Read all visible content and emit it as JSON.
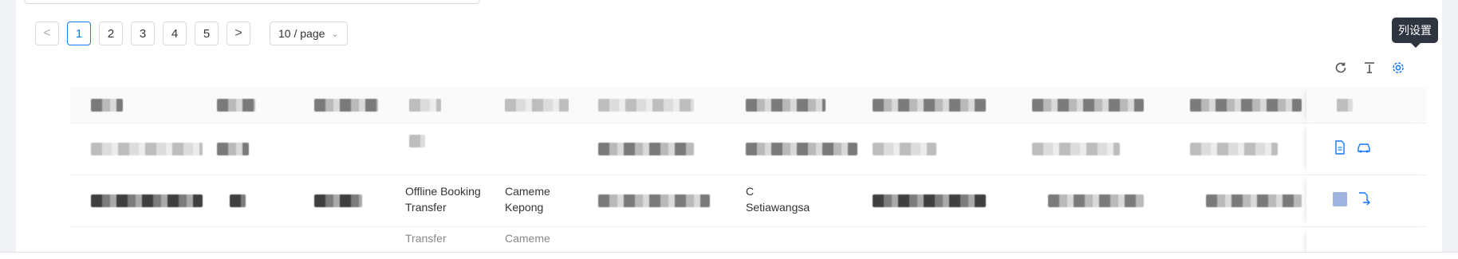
{
  "pagination": {
    "prev_label": "<",
    "next_label": ">",
    "pages": [
      "1",
      "2",
      "3",
      "4",
      "5"
    ],
    "current": "1",
    "page_size": "10 / page"
  },
  "toolbar": {
    "tooltip": "列设置",
    "icons": [
      "refresh-icon",
      "column-height-icon",
      "setting-icon"
    ]
  },
  "table": {
    "rows": [
      {
        "col3": "",
        "col4": "",
        "col6": ""
      },
      {
        "col3": "Offline Booking",
        "col3b": "Transfer",
        "col4": "Cameme",
        "col4b": "Kepong",
        "col6": "C",
        "col6b": "Setiawangsa"
      },
      {
        "col3": "Transfer",
        "col4": "Cameme"
      }
    ]
  },
  "colors": {
    "accent": "#1677ff",
    "tooltip_bg": "#2e3440"
  }
}
